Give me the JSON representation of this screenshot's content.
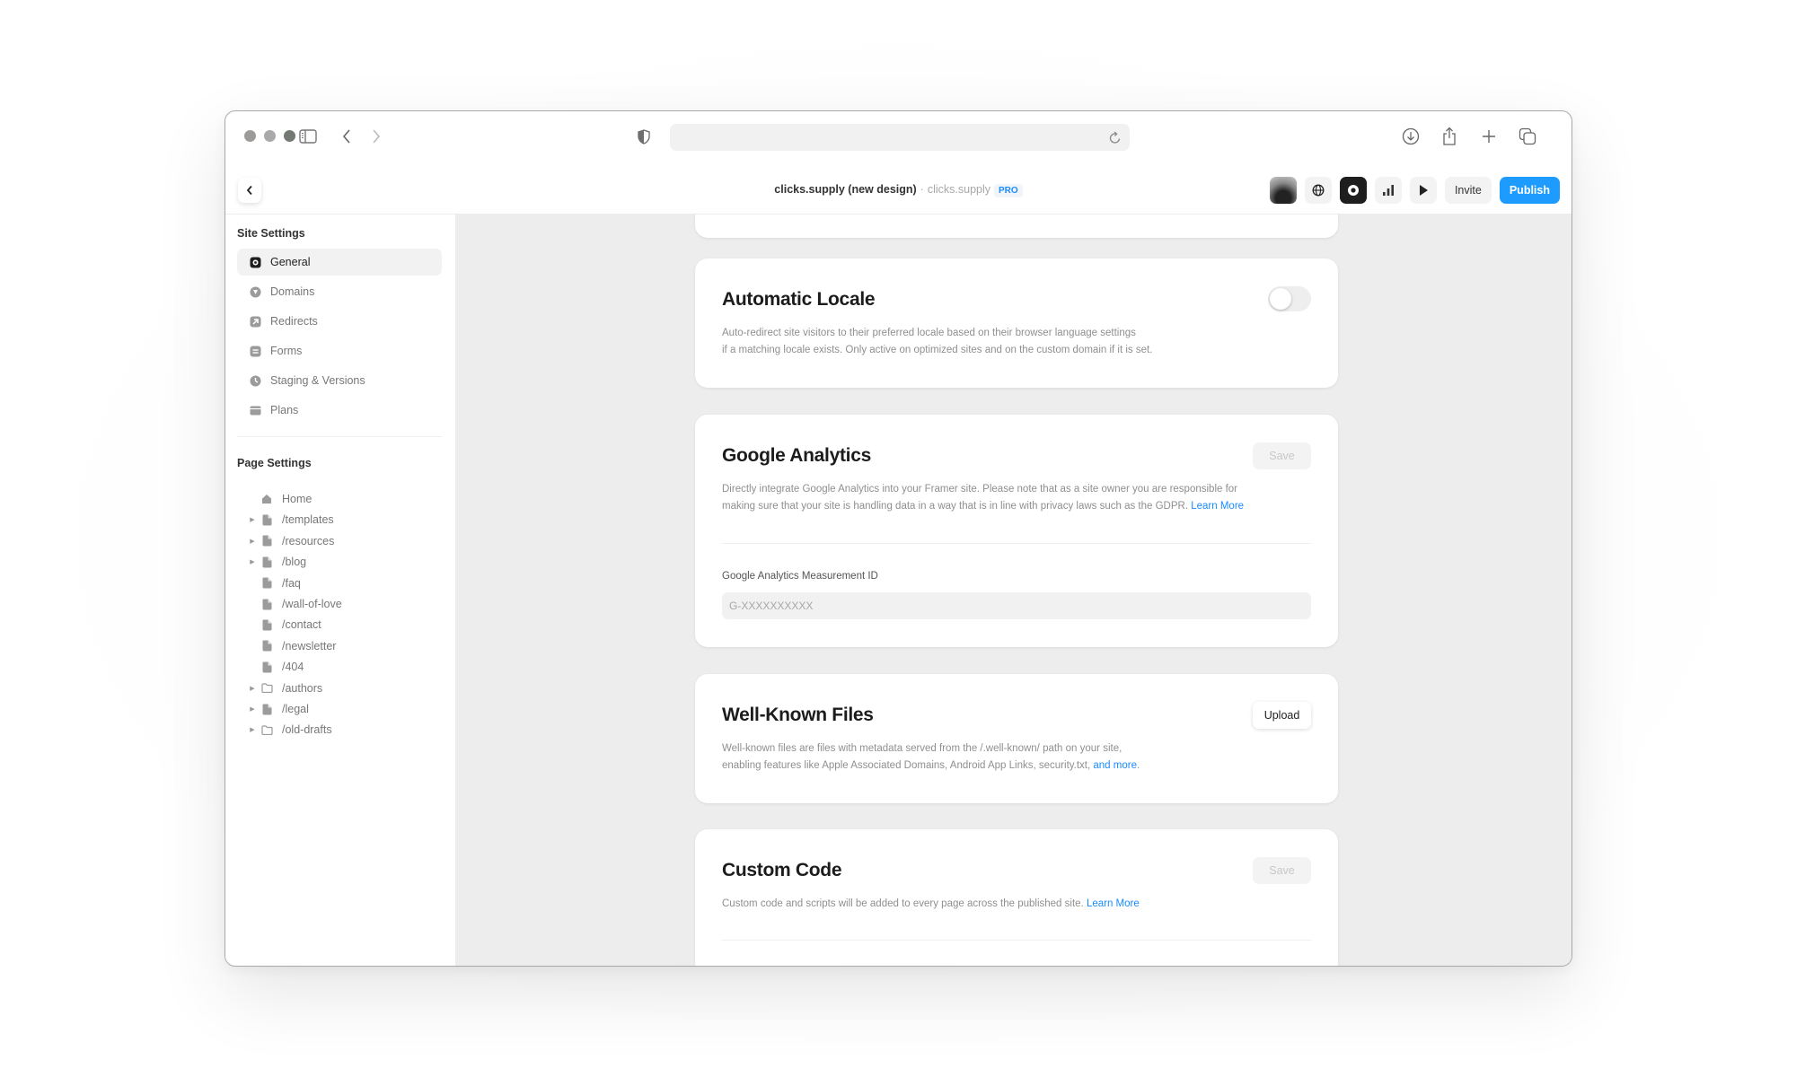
{
  "browser": {
    "back_label": "Back",
    "forward_label": "Forward",
    "address_value": ""
  },
  "header": {
    "project_name": "clicks.supply (new design)",
    "separator": "·",
    "domain": "clicks.supply",
    "plan_badge": "PRO",
    "invite_label": "Invite",
    "publish_label": "Publish",
    "accent_color": "#1e9bff"
  },
  "sidebar": {
    "site_settings_title": "Site Settings",
    "site_items": [
      {
        "label": "General",
        "icon": "gear-icon",
        "active": true
      },
      {
        "label": "Domains",
        "icon": "globe-icon",
        "active": false
      },
      {
        "label": "Redirects",
        "icon": "redirect-icon",
        "active": false
      },
      {
        "label": "Forms",
        "icon": "form-icon",
        "active": false
      },
      {
        "label": "Staging & Versions",
        "icon": "clock-icon",
        "active": false
      },
      {
        "label": "Plans",
        "icon": "card-icon",
        "active": false
      }
    ],
    "page_settings_title": "Page Settings",
    "pages": [
      {
        "label": "Home",
        "icon": "home-icon",
        "expandable": false
      },
      {
        "label": "/templates",
        "icon": "page-icon",
        "expandable": true
      },
      {
        "label": "/resources",
        "icon": "page-icon",
        "expandable": true
      },
      {
        "label": "/blog",
        "icon": "page-icon",
        "expandable": true
      },
      {
        "label": "/faq",
        "icon": "page-icon",
        "expandable": false
      },
      {
        "label": "/wall-of-love",
        "icon": "page-icon",
        "expandable": false
      },
      {
        "label": "/contact",
        "icon": "page-icon",
        "expandable": false
      },
      {
        "label": "/newsletter",
        "icon": "page-icon",
        "expandable": false
      },
      {
        "label": "/404",
        "icon": "page-icon",
        "expandable": false
      },
      {
        "label": "/authors",
        "icon": "folder-icon",
        "expandable": true
      },
      {
        "label": "/legal",
        "icon": "page-icon",
        "expandable": true
      },
      {
        "label": "/old-drafts",
        "icon": "folder-icon",
        "expandable": true
      }
    ]
  },
  "main": {
    "automatic_locale": {
      "title": "Automatic Locale",
      "description_line1": "Auto-redirect site visitors to their preferred locale based on their browser language settings",
      "description_line2": "if a matching locale exists. Only active on optimized sites and on the custom domain if it is set.",
      "enabled": false
    },
    "google_analytics": {
      "title": "Google Analytics",
      "save_label": "Save",
      "description_line1": "Directly integrate Google Analytics into your Framer site. Please note that as a site owner you are responsible for",
      "description_line2": "making sure that your site is handling data in a way that is in line with privacy laws such as the GDPR.",
      "learn_more": "Learn More",
      "field_label": "Google Analytics Measurement ID",
      "field_placeholder": "G-XXXXXXXXXX",
      "field_value": ""
    },
    "well_known_files": {
      "title": "Well-Known Files",
      "upload_label": "Upload",
      "description_line1": "Well-known files are files with metadata served from the /.well-known/ path on your site,",
      "description_line2": "enabling features like Apple Associated Domains, Android App Links, security.txt,",
      "and_more": "and more",
      "period": "."
    },
    "custom_code": {
      "title": "Custom Code",
      "save_label": "Save",
      "description": "Custom code and scripts will be added to every page across the published site.",
      "learn_more": "Learn More"
    }
  }
}
